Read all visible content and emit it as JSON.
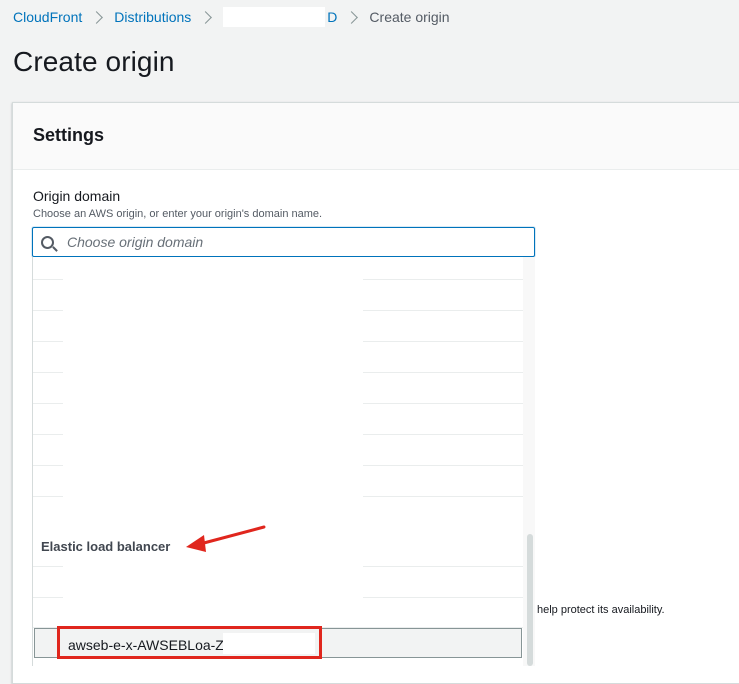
{
  "breadcrumb": {
    "items": [
      "CloudFront",
      "Distributions"
    ],
    "distribution_suffix": "D",
    "current": "Create origin"
  },
  "page": {
    "title": "Create origin"
  },
  "panel": {
    "title": "Settings"
  },
  "origin_domain": {
    "label": "Origin domain",
    "description": "Choose an AWS origin, or enter your origin's domain name.",
    "placeholder": "Choose origin domain"
  },
  "dropdown": {
    "group_label": "Elastic load balancer",
    "selected_option": "awseb-e-x-AWSEBLoa-Z"
  },
  "help_text": "help protect its availability.",
  "colors": {
    "link": "#0073bb",
    "annotation": "#e0261d",
    "focus": "#0073bb"
  },
  "icons": [
    "chevron-right-icon",
    "search-icon",
    "annotation-arrow-icon"
  ]
}
